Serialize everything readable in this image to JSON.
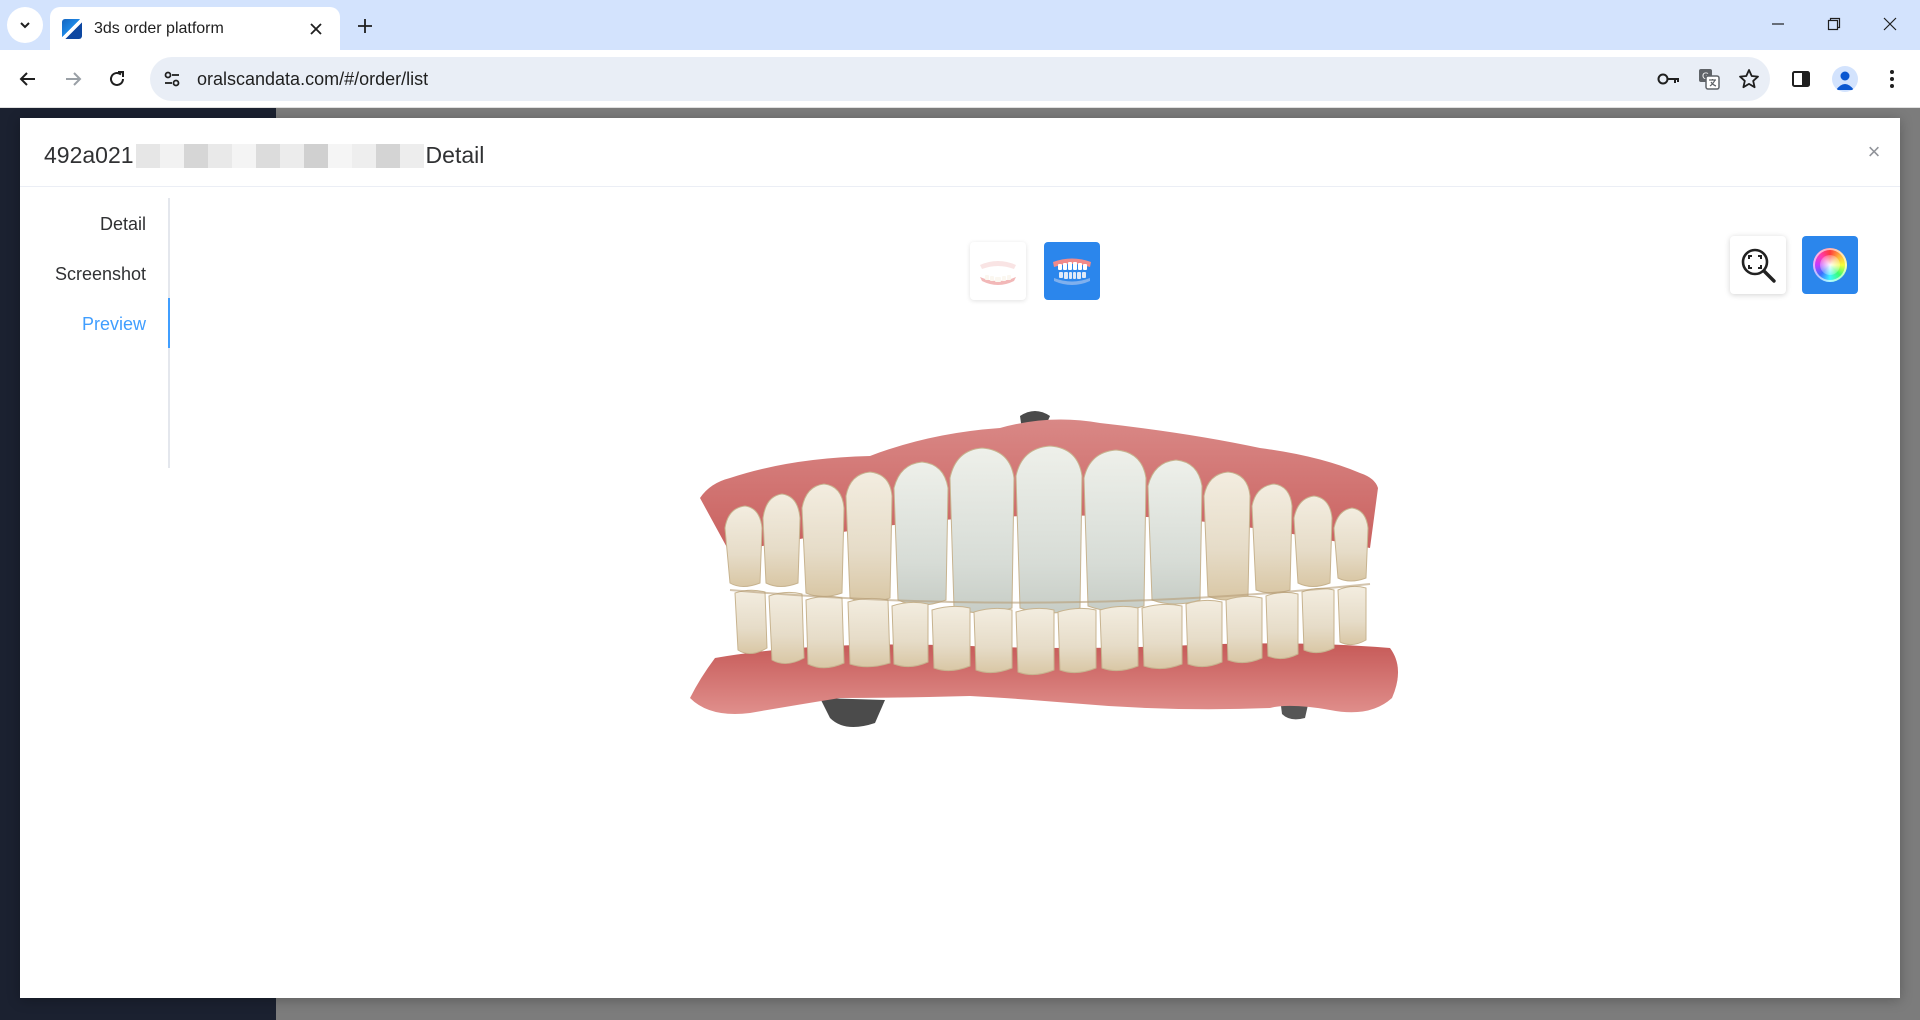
{
  "browser": {
    "tab_title": "3ds order platform",
    "url": "oralscandata.com/#/order/list"
  },
  "dialog": {
    "title_prefix": "492a021",
    "title_suffix": "Detail",
    "close_symbol": "×"
  },
  "side_tabs": [
    {
      "label": "Detail",
      "active": false
    },
    {
      "label": "Screenshot",
      "active": false
    },
    {
      "label": "Preview",
      "active": true
    }
  ],
  "colors": {
    "accent": "#409eff",
    "button_blue": "#2b86ec",
    "tab_strip": "#d3e3fd",
    "omnibox": "#e9eef6",
    "sidebar_dark": "#1b2130",
    "overlay_gray": "#7c7c7c"
  },
  "icons": {
    "view_single_jaw": "lower-jaw-icon",
    "view_both_jaws": "dental-arch-icon",
    "zoom_fit": "zoom-fit-icon",
    "color_mode": "color-wheel-icon"
  }
}
